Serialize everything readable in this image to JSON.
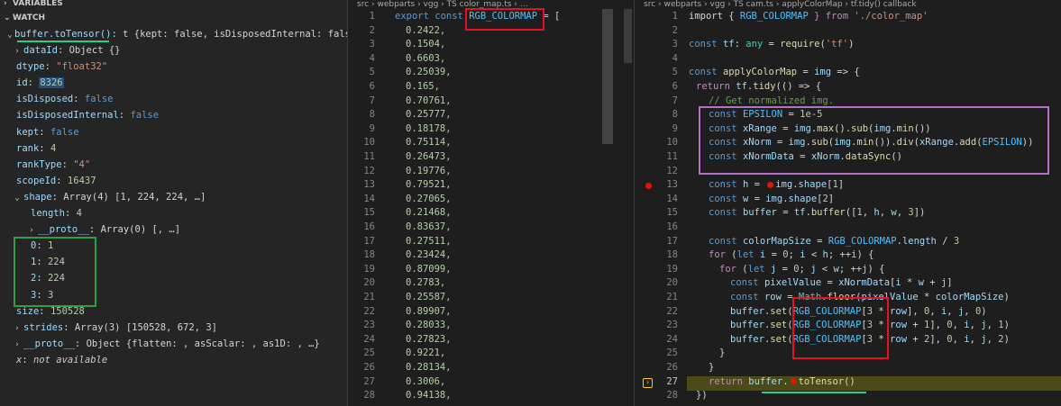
{
  "debug": {
    "variables_header": "VARIABLES",
    "watch_header": "WATCH",
    "watch_expr": "buffer.toTensor():",
    "watch_value": "t {kept: false, isDisposedInternal: false…",
    "rows": [
      {
        "key": "dataId",
        "value": "Object {}",
        "vtype": "plain",
        "twisty": "›"
      },
      {
        "key": "dtype",
        "value": "\"float32\"",
        "vtype": "str"
      },
      {
        "key": "id",
        "value": "8326",
        "vtype": "hl"
      },
      {
        "key": "isDisposed",
        "value": "false",
        "vtype": "kw"
      },
      {
        "key": "isDisposedInternal",
        "value": "false",
        "vtype": "kw"
      },
      {
        "key": "kept",
        "value": "false",
        "vtype": "kw"
      },
      {
        "key": "rank",
        "value": "4",
        "vtype": "num"
      },
      {
        "key": "rankType",
        "value": "\"4\"",
        "vtype": "str"
      },
      {
        "key": "scopeId",
        "value": "16437",
        "vtype": "num"
      },
      {
        "key": "shape",
        "value": "Array(4) [1, 224, 224, …]",
        "vtype": "plain",
        "twisty": "⌄"
      },
      {
        "key": "length",
        "value": "4",
        "vtype": "num",
        "indent": 1
      },
      {
        "key": "__proto__",
        "value": "Array(0) [, …]",
        "vtype": "plain",
        "twisty": "›",
        "indent": 1
      },
      {
        "key": "0",
        "value": "1",
        "vtype": "num",
        "indent": 1
      },
      {
        "key": "1",
        "value": "224",
        "vtype": "num",
        "indent": 1
      },
      {
        "key": "2",
        "value": "224",
        "vtype": "num",
        "indent": 1
      },
      {
        "key": "3",
        "value": "3",
        "vtype": "num",
        "indent": 1
      },
      {
        "key": "size",
        "value": "150528",
        "vtype": "num"
      },
      {
        "key": "strides",
        "value": "Array(3) [150528, 672, 3]",
        "vtype": "plain",
        "twisty": "›"
      },
      {
        "key": "__proto__",
        "value": "Object {flatten: , asScalar: , as1D: , …}",
        "vtype": "plain",
        "twisty": "›"
      },
      {
        "key": "x",
        "value": "not available",
        "vtype": "ital"
      }
    ]
  },
  "editor1": {
    "breadcrumb": "src › webparts › vgg › TS color_map.ts › …",
    "lines": [
      "1",
      "2",
      "3",
      "4",
      "5",
      "6",
      "7",
      "8",
      "9",
      "10",
      "11",
      "12",
      "13",
      "14",
      "15",
      "16",
      "17",
      "18",
      "19",
      "20",
      "21",
      "22",
      "23",
      "24",
      "25",
      "26",
      "27",
      "28"
    ],
    "export_kw": "export",
    "const_kw": "const",
    "colormap_name": "RGB_COLORMAP",
    "assign": " = [",
    "values": [
      "0.2422,",
      "0.1504,",
      "0.6603,",
      "0.25039,",
      "0.165,",
      "0.70761,",
      "0.25777,",
      "0.18178,",
      "0.75114,",
      "0.26473,",
      "0.19776,",
      "0.79521,",
      "0.27065,",
      "0.21468,",
      "0.83637,",
      "0.27511,",
      "0.23424,",
      "0.87099,",
      "0.2783,",
      "0.25587,",
      "0.89907,",
      "0.28033,",
      "0.27823,",
      "0.9221,",
      "0.28134,",
      "0.3006,",
      "0.94138,"
    ]
  },
  "editor2": {
    "breadcrumb": "src › webparts › vgg › TS cam.ts › applyColorMap › tf.tidy() callback",
    "lines": [
      "1",
      "2",
      "3",
      "4",
      "5",
      "6",
      "7",
      "8",
      "9",
      "10",
      "11",
      "12",
      "13",
      "14",
      "15",
      "16",
      "17",
      "18",
      "19",
      "20",
      "21",
      "22",
      "23",
      "24",
      "25",
      "26",
      "27",
      "28"
    ],
    "code": {
      "l1": [
        "import { ",
        "RGB_COLORMAP",
        " } from ",
        "'./color_map'"
      ],
      "l3": [
        "const ",
        "tf",
        ": ",
        "any",
        " = ",
        "require",
        "(",
        "'tf'",
        ")"
      ],
      "l5": [
        "const ",
        "applyColorMap",
        " = ",
        "img",
        " => {"
      ],
      "l6": [
        "return ",
        "tf",
        ".",
        "tidy",
        "(() => {"
      ],
      "l7": "// Get normalized img.",
      "l8": [
        "const ",
        "EPSILON",
        " = ",
        "1e-5"
      ],
      "l9": [
        "const ",
        "xRange",
        " = ",
        "img",
        ".",
        "max",
        "().",
        "sub",
        "(",
        "img",
        ".",
        "min",
        "())"
      ],
      "l10": [
        "const ",
        "xNorm",
        " = ",
        "img",
        ".",
        "sub",
        "(",
        "img",
        ".",
        "min",
        "()).",
        "div",
        "(",
        "xRange",
        ".",
        "add",
        "(",
        "EPSILON",
        "))"
      ],
      "l11": [
        "const ",
        "xNormData",
        " = ",
        "xNorm",
        ".",
        "dataSync",
        "()"
      ],
      "l13": [
        "const ",
        "h",
        " = ",
        "img",
        ".",
        "shape",
        "[",
        "1",
        "]"
      ],
      "l14": [
        "const ",
        "w",
        " = ",
        "img",
        ".",
        "shape",
        "[",
        "2",
        "]"
      ],
      "l15": [
        "const ",
        "buffer",
        " = ",
        "tf",
        ".",
        "buffer",
        "([",
        "1",
        ", ",
        "h",
        ", ",
        "w",
        ", ",
        "3",
        "])"
      ],
      "l17": [
        "const ",
        "colorMapSize",
        " = ",
        "RGB_COLORMAP",
        ".",
        "length",
        " / ",
        "3"
      ],
      "l18": [
        "for",
        " (",
        "let ",
        "i",
        " = ",
        "0",
        "; ",
        "i",
        " < ",
        "h",
        "; ++",
        "i",
        ") {"
      ],
      "l19": [
        "for",
        " (",
        "let ",
        "j",
        " = ",
        "0",
        "; ",
        "j",
        " < ",
        "w",
        "; ++",
        "j",
        ") {"
      ],
      "l20": [
        "const ",
        "pixelValue",
        " = ",
        "xNormData",
        "[",
        "i",
        " * ",
        "w",
        " + ",
        "j",
        "]"
      ],
      "l21": [
        "const ",
        "row",
        " = ",
        "Math",
        ".",
        "floor",
        "(",
        "pixelValue",
        " * ",
        "colorMapSize",
        ")"
      ],
      "l22": [
        "buffer",
        ".",
        "set",
        "(",
        "RGB_COLORMAP",
        "[",
        "3",
        " * ",
        "row",
        "], ",
        "0",
        ", ",
        "i",
        ", ",
        "j",
        ", ",
        "0",
        ")"
      ],
      "l23": [
        "buffer",
        ".",
        "set",
        "(",
        "RGB_COLORMAP",
        "[",
        "3",
        " * ",
        "row",
        " + ",
        "1",
        "], ",
        "0",
        ", ",
        "i",
        ", ",
        "j",
        ", ",
        "1",
        ")"
      ],
      "l24": [
        "buffer",
        ".",
        "set",
        "(",
        "RGB_COLORMAP",
        "[",
        "3",
        " * ",
        "row",
        " + ",
        "2",
        "], ",
        "0",
        ", ",
        "i",
        ", ",
        "j",
        ", ",
        "2",
        ")"
      ],
      "l25": "}",
      "l26": "}",
      "l27": [
        "return ",
        "buffer",
        ".",
        "toTensor",
        "()"
      ],
      "l28": "})"
    }
  },
  "colors": {
    "green_box": "#2ea043",
    "red_box": "#e81123",
    "purple_box": "#b86fc9",
    "underline_green": "#23d18b",
    "breakpoint": "#e51400",
    "current_line": "#4b4b18"
  }
}
